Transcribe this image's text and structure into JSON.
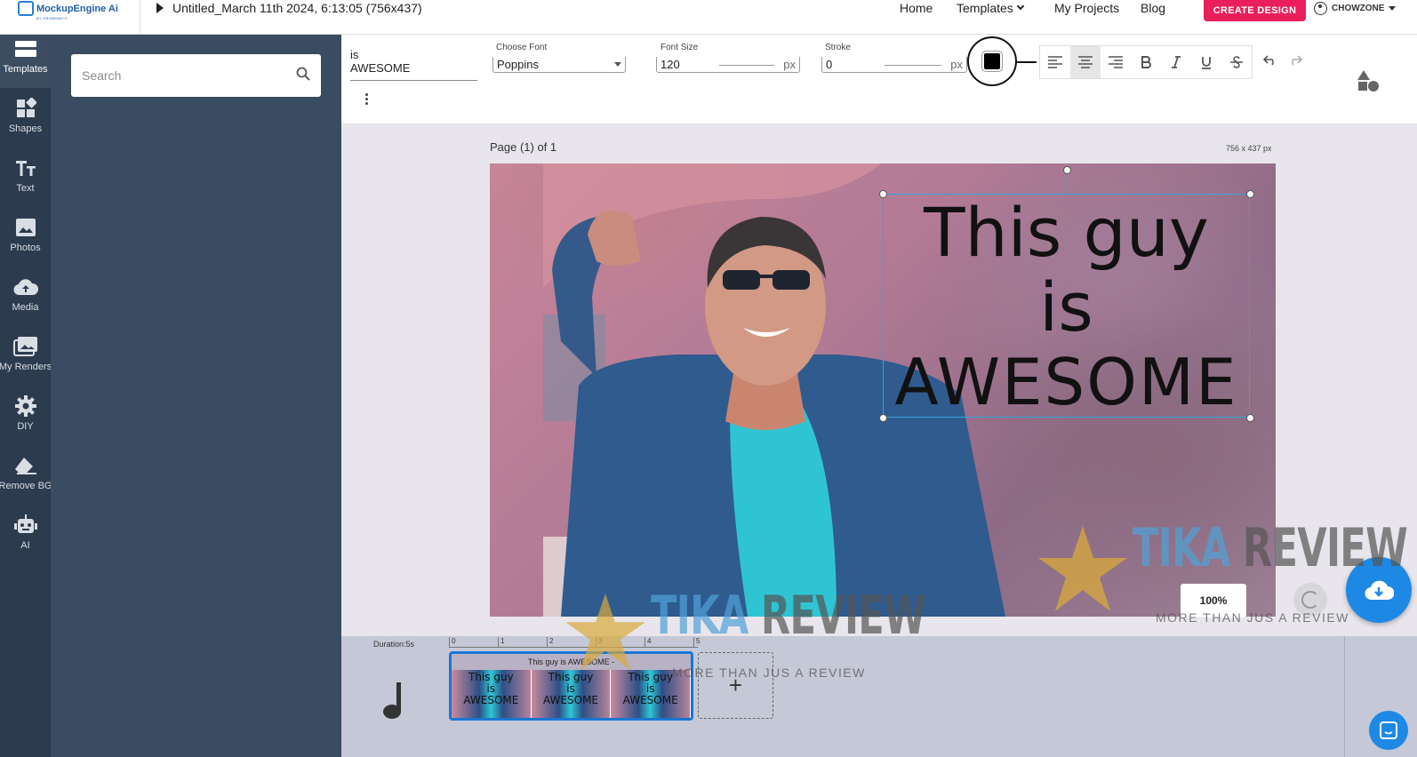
{
  "app": {
    "logo_text": "MockupEngine Ai",
    "logo_sub": "BY GROWMATIC",
    "doc_title": "Untitled_March 11th 2024, 6:13:05 (756x437)"
  },
  "nav": {
    "home": "Home",
    "templates": "Templates",
    "projects": "My Projects",
    "blog": "Blog",
    "create": "CREATE DESIGN",
    "user": "CHOWZONE"
  },
  "rail": [
    {
      "label": "Templates",
      "icon": "templates-icon"
    },
    {
      "label": "Shapes",
      "icon": "shapes-icon"
    },
    {
      "label": "Text",
      "icon": "text-icon"
    },
    {
      "label": "Photos",
      "icon": "photos-icon"
    },
    {
      "label": "Media",
      "icon": "cloud-upload-icon"
    },
    {
      "label": "My Renders",
      "icon": "renders-icon"
    },
    {
      "label": "DIY",
      "icon": "gear-icon"
    },
    {
      "label": "Remove BG",
      "icon": "eraser-icon"
    },
    {
      "label": "AI",
      "icon": "robot-icon"
    }
  ],
  "search": {
    "placeholder": "Search"
  },
  "toolbar": {
    "text_preview": "is\nAWESOME",
    "font_label": "Choose Font",
    "font_value": "Poppins",
    "size_label": "Font Size",
    "size_value": "120",
    "size_unit": "px",
    "stroke_label": "Stroke",
    "stroke_value": "0",
    "stroke_unit": "px",
    "text_color": "#000000"
  },
  "canvas": {
    "page_label": "Page (1) of 1",
    "dims": "756 x 437 px",
    "text_lines": [
      "This guy",
      "is",
      "AWESOME"
    ],
    "zoom": "100%"
  },
  "timeline": {
    "duration": "Duration:5s",
    "ticks": [
      "0",
      "1",
      "2",
      "3",
      "4",
      "5"
    ],
    "clip_title": "This guy is AWESOME -",
    "thumb_text": "This guy\nis\nAWESOME",
    "add_label": "+"
  },
  "watermark": {
    "word1": "TIKA",
    "word2": "REVIEW",
    "tagline": "MORE THAN JUS A REVIEW"
  },
  "colors": {
    "accent": "#e91e5a",
    "rail_bg": "#2c3b4d",
    "panel_bg": "#3a4c61",
    "selection": "#36a3d9",
    "primary_blue": "#1e88e5"
  }
}
